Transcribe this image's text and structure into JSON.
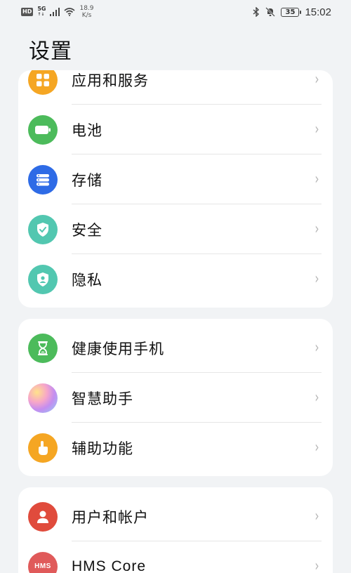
{
  "status_bar": {
    "hd": "HD",
    "network": "5G",
    "network_sub": "↑↓",
    "speed_value": "18.9",
    "speed_unit": "K/s",
    "battery": "35",
    "time": "15:02"
  },
  "page": {
    "title": "设置"
  },
  "groups": [
    {
      "items": [
        {
          "label": "应用和服务",
          "icon": "apps-icon",
          "color": "#f5a623"
        },
        {
          "label": "电池",
          "icon": "battery-icon",
          "color": "#4cbb5b"
        },
        {
          "label": "存储",
          "icon": "storage-icon",
          "color": "#2e6be6"
        },
        {
          "label": "安全",
          "icon": "shield-check-icon",
          "color": "#52c7b0"
        },
        {
          "label": "隐私",
          "icon": "privacy-shield-icon",
          "color": "#52c7b0"
        }
      ]
    },
    {
      "items": [
        {
          "label": "健康使用手机",
          "icon": "hourglass-icon",
          "color": "#4cbb5b"
        },
        {
          "label": "智慧助手",
          "icon": "assistant-orb-icon",
          "color": "#e98bd0"
        },
        {
          "label": "辅助功能",
          "icon": "hand-pointer-icon",
          "color": "#f5a623"
        }
      ]
    },
    {
      "items": [
        {
          "label": "用户和帐户",
          "icon": "user-icon",
          "color": "#e04b3c"
        },
        {
          "label": "HMS Core",
          "icon": "hms-icon",
          "color": "#e05a5a"
        }
      ]
    }
  ],
  "chevron": "›",
  "hms_icon_text": "HMS"
}
